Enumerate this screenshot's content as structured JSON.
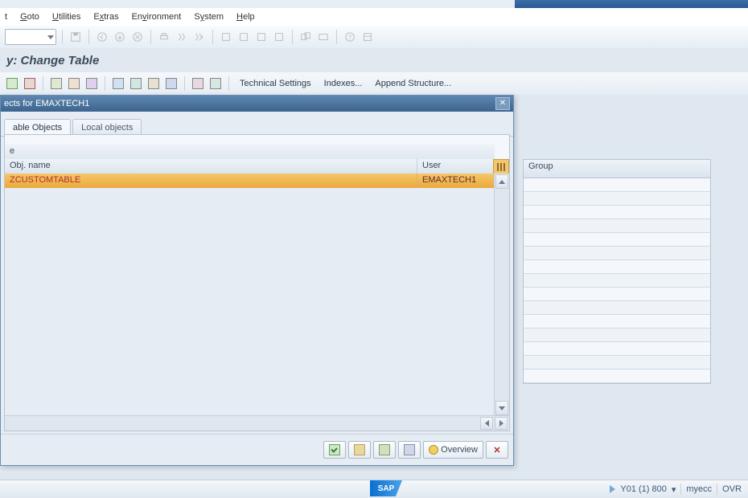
{
  "menu": {
    "goto": "Goto",
    "utilities": "Utilities",
    "extras": "Extras",
    "environment": "Environment",
    "system": "System",
    "help": "Help",
    "first": "t"
  },
  "page_title": "y: Change Table",
  "app_toolbar": {
    "technical": "Technical Settings",
    "indexes": "Indexes...",
    "append": "Append Structure..."
  },
  "dialog": {
    "title": "ects for EMAXTECH1",
    "tabs": {
      "transportable": "able Objects",
      "local": "Local objects"
    },
    "upper_header": "e",
    "columns": {
      "obj": "Obj. name",
      "user": "User"
    },
    "row": {
      "obj": "ZCUSTOMTABLE",
      "user": "EMAXTECH1"
    },
    "footer": {
      "overview": "Overview",
      "cancel": "✕"
    }
  },
  "bg": {
    "group": "Group"
  },
  "status": {
    "sap": "SAP",
    "system": "Y01 (1) 800",
    "server": "myecc",
    "mode": "OVR",
    "arrow": "▾"
  }
}
